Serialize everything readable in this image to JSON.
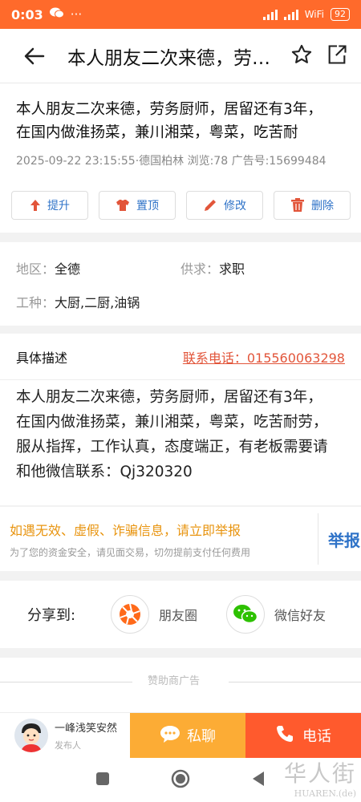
{
  "status_bar": {
    "time": "0:03",
    "dots": "···",
    "wifi": "WiFi",
    "battery": "92"
  },
  "header": {
    "title": "本人朋友二次来德，劳…"
  },
  "post": {
    "title_line1": "本人朋友二次来德，劳务厨师，居留还有3年，",
    "title_line2": "在国内做淮扬菜，兼川湘菜，粤菜，吃苦耐",
    "meta": "2025-09-22 23:15:55·德国柏林   浏览:78   广告号:15699484"
  },
  "actions": {
    "promote": "提升",
    "pin": "置顶",
    "edit": "修改",
    "delete": "删除"
  },
  "info": {
    "region_label": "地区：",
    "region_value": "全德",
    "supply_label": "供求：",
    "supply_value": "求职",
    "job_label": "工种：",
    "job_value": "大厨,二厨,油锅"
  },
  "description": {
    "label": "具体描述",
    "phone": "联系电话：015560063298",
    "line1": "本人朋友二次来德，劳务厨师，居留还有3年，",
    "line2": "在国内做淮扬菜，兼川湘菜，粤菜，吃苦耐劳，",
    "line3": "服从指挥，工作认真，态度端正，有老板需要请",
    "line4": "和他微信联系：Qj320320"
  },
  "report": {
    "warning": "如遇无效、虚假、诈骗信息，请立即举报",
    "notice": "为了您的资金安全，请见面交易，切勿提前支付任何费用",
    "button": "举报"
  },
  "share": {
    "label": "分享到:",
    "moments": "朋友圈",
    "wechat_friends": "微信好友"
  },
  "ad": {
    "text": "赞助商广告"
  },
  "bottom": {
    "publisher_name": "一峰浅笑安然",
    "publisher_role": "发布人",
    "chat": "私聊",
    "call": "电话"
  },
  "watermark": {
    "brand": "华人街",
    "domain": "HUAREN.(de)"
  },
  "colors": {
    "accent": "#ff6a2b",
    "link": "#2f73c8",
    "chat": "#fcac35",
    "call": "#ff5a2d",
    "warn": "#e8940f",
    "phone": "#e2553a"
  }
}
